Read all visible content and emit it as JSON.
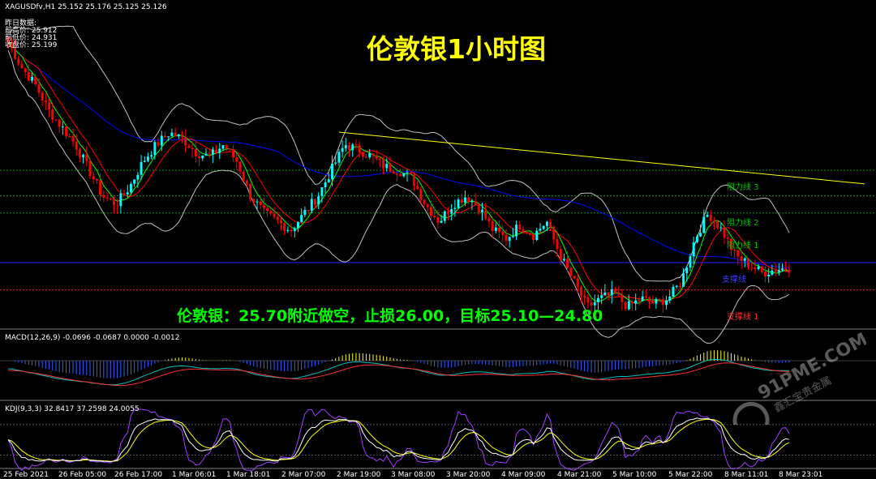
{
  "header": {
    "symbol_line": "XAGUSDfv,H1  25.152 25.176 25.125 25.126",
    "prev_data_label": "昨日数据:",
    "prev_high": "前高价: 25.912",
    "prev_low": "前低价: 24.931",
    "prev_close": "收盘价: 25.199"
  },
  "title": "伦敦银1小时图",
  "strategy_text": "伦敦银：25.70附近做空，止损26.00，目标25.10—24.80",
  "levels": {
    "r3": "阻力线 3",
    "r2": "阻力线 2",
    "r1": "阻力线 1",
    "s_blue": "支撑线",
    "s1": "支撑线 1"
  },
  "colors": {
    "background": "#000000",
    "bull": "#00ffff",
    "bear": "#ff0000",
    "title": "#ffff00",
    "strategy": "#00ff00",
    "bollinger": "#c0c0c0",
    "ma_long": "#0000ff",
    "trendline": "#ffff00",
    "ma_fast": "#00ff00",
    "ma_slow": "#ff0000"
  },
  "macd": {
    "label": "MACD(12,26,9) -0.0696 -0.0687 0.0000 -0.0012"
  },
  "kdj": {
    "label": "KDJ(9,3,3) 32.8417 37.2598 24.0055"
  },
  "x_ticks": [
    "25 Feb 2021",
    "26 Feb 05:00",
    "26 Feb 17:00",
    "1 Mar 06:01",
    "1 Mar 18:01",
    "2 Mar 07:00",
    "2 Mar 19:00",
    "3 Mar 08:00",
    "3 Mar 20:00",
    "4 Mar 09:00",
    "4 Mar 21:00",
    "5 Mar 10:00",
    "5 Mar 22:00",
    "8 Mar 11:01",
    "8 Mar 23:01"
  ],
  "watermark": {
    "brand": "91PME.COM",
    "sub": "鑫汇宝贵金属"
  },
  "chart_data": {
    "type": "candlestick",
    "symbol": "XAGUSDfv",
    "timeframe": "H1",
    "ohlc_last": {
      "open": 25.152,
      "high": 25.176,
      "low": 25.125,
      "close": 25.126
    },
    "close_path": [
      26.45,
      26.3,
      26.2,
      26.05,
      25.95,
      25.85,
      25.7,
      25.55,
      25.5,
      25.6,
      25.75,
      25.85,
      25.92,
      25.88,
      25.8,
      25.78,
      25.85,
      25.75,
      25.55,
      25.45,
      25.4,
      25.35,
      25.45,
      25.55,
      25.7,
      25.85,
      25.82,
      25.78,
      25.72,
      25.7,
      25.65,
      25.5,
      25.4,
      25.5,
      25.55,
      25.48,
      25.35,
      25.3,
      25.38,
      25.32,
      25.4,
      25.2,
      25.05,
      24.9,
      24.95,
      24.98,
      24.9,
      24.95,
      24.92,
      24.95,
      25.05,
      25.3,
      25.45,
      25.35,
      25.2,
      25.15,
      25.1,
      25.12,
      25.13
    ],
    "levels": [
      {
        "name": "阻力线 3",
        "value": 25.7
      },
      {
        "name": "阻力线 2",
        "value": 25.55
      },
      {
        "name": "阻力线 1",
        "value": 25.45
      },
      {
        "name": "支撑线",
        "value": 25.16
      },
      {
        "name": "支撑线 1",
        "value": 25.0
      }
    ],
    "ylim": [
      24.8,
      26.6
    ],
    "grid": false,
    "legend": "none"
  }
}
